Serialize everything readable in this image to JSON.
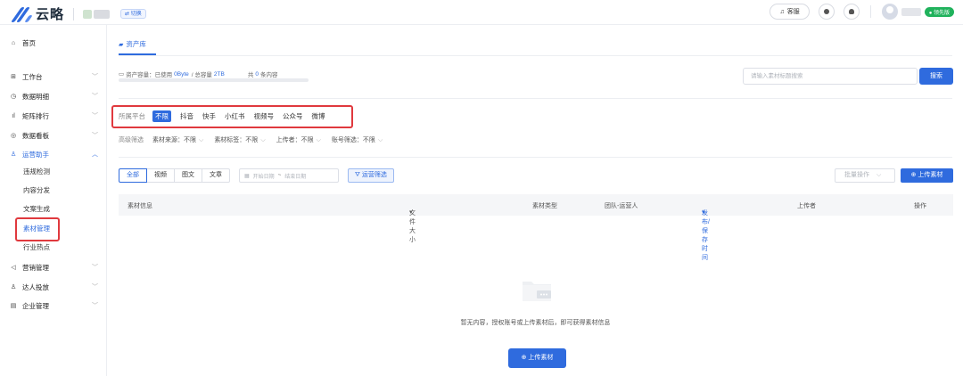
{
  "header": {
    "logo_text": "云略",
    "switch_label": "⇄ 切换",
    "service_label": "客服",
    "vip_label": "● 领先版",
    "brand_color": "#2f6bde"
  },
  "sidebar": {
    "items": [
      {
        "label": "首页",
        "icon": "home-icon",
        "glyph": "⌂"
      },
      {
        "label": "工作台",
        "icon": "grid-icon",
        "glyph": "⊞"
      },
      {
        "label": "数据明细",
        "icon": "data-icon",
        "glyph": "◷"
      },
      {
        "label": "矩阵排行",
        "icon": "ranking-icon",
        "glyph": "ıl"
      },
      {
        "label": "数据看板",
        "icon": "dashboard-icon",
        "glyph": "◎"
      },
      {
        "label": "运营助手",
        "icon": "assistant-icon",
        "glyph": "♙"
      },
      {
        "label": "营销管理",
        "icon": "marketing-icon",
        "glyph": "◁"
      },
      {
        "label": "达人投放",
        "icon": "influencer-icon",
        "glyph": "♙"
      },
      {
        "label": "企业管理",
        "icon": "enterprise-icon",
        "glyph": "▤"
      }
    ],
    "sub_items": [
      "违规检测",
      "内容分发",
      "文案生成",
      "素材管理",
      "行业热点"
    ]
  },
  "main": {
    "tab_label": "资产库",
    "storage": {
      "prefix": "资产容量：已使用",
      "used": "0Byte",
      "sep": "/ 总容量",
      "total": "2TB",
      "count_prefix": "共",
      "count": "0",
      "count_suffix": "条内容"
    },
    "search_placeholder": "请输入素材标题搜索",
    "search_button": "搜索",
    "platform": {
      "label": "所属平台",
      "options": [
        "不限",
        "抖音",
        "快手",
        "小红书",
        "视频号",
        "公众号",
        "微博"
      ]
    },
    "advanced": {
      "label": "高级筛选",
      "filters": [
        "素材来源：不限",
        "素材标签：不限",
        "上传者：不限",
        "账号筛选：不限"
      ]
    },
    "type_tabs": [
      "全部",
      "视频",
      "图文",
      "文章"
    ],
    "date_start": "开始日期",
    "date_sep": "~",
    "date_end": "结束日期",
    "op_filter": "运营筛选",
    "batch_op": "批量操作",
    "upload_label": "上传素材",
    "columns": [
      "素材信息",
      "文件大小",
      "素材类型",
      "团队-运营人",
      "发布/保存时间",
      "上传者",
      "操作"
    ],
    "empty_text": "暂无内容，授权账号或上传素材后，即可获得素材信息"
  }
}
